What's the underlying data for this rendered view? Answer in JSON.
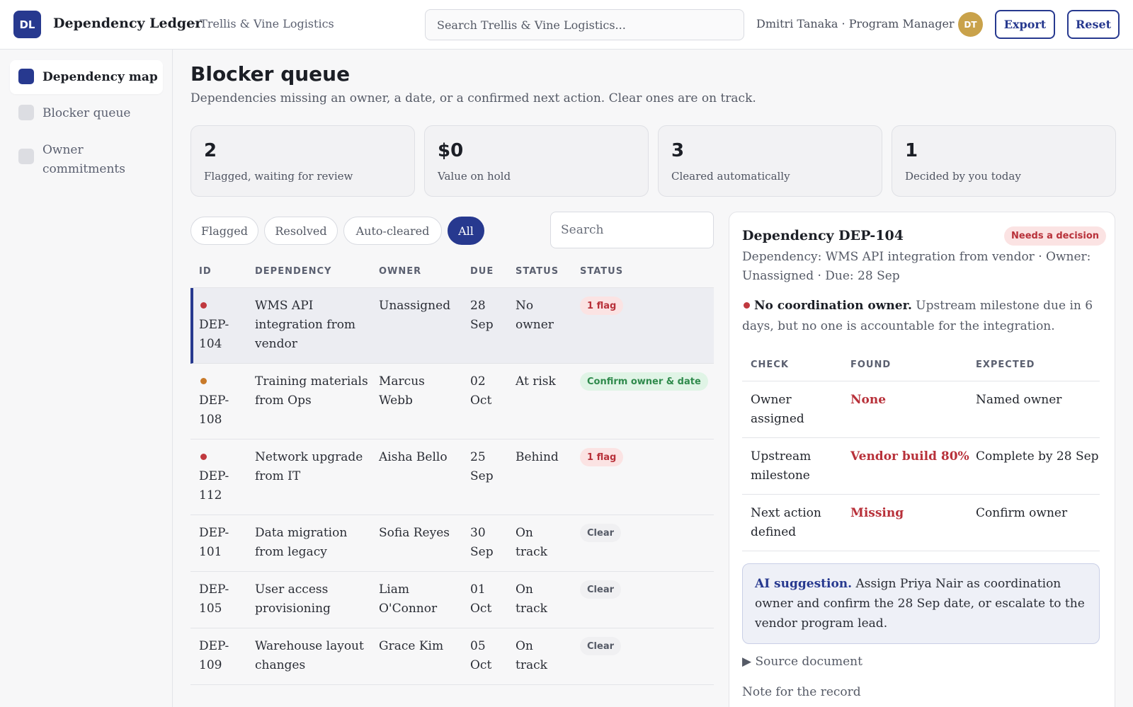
{
  "header": {
    "logo": "DL",
    "app_title": "Dependency Ledger",
    "org": "· Trellis & Vine Logistics",
    "search_placeholder": "Search Trellis & Vine Logistics...",
    "user": "Dmitri Tanaka · Program Manager",
    "avatar": "DT",
    "export_label": "Export",
    "reset_label": "Reset",
    "accent_color": "#27398f"
  },
  "sidebar": {
    "items": [
      {
        "label": "Dependency map",
        "icon": "square-icon",
        "active": true
      },
      {
        "label": "Blocker queue",
        "icon": "square-icon",
        "active": false
      },
      {
        "label": "Owner commitments",
        "icon": "square-icon",
        "active": false
      }
    ]
  },
  "main": {
    "title": "Blocker queue",
    "subtitle": "Dependencies missing an owner, a date, or a confirmed next action. Clear ones are on track.",
    "stats": [
      {
        "value": "2",
        "label": "Flagged, waiting for review"
      },
      {
        "value": "$0",
        "label": "Value on hold"
      },
      {
        "value": "3",
        "label": "Cleared automatically"
      },
      {
        "value": "1",
        "label": "Decided by you today"
      }
    ],
    "filters": [
      {
        "label": "Flagged",
        "active": false
      },
      {
        "label": "Resolved",
        "active": false
      },
      {
        "label": "Auto-cleared",
        "active": false
      },
      {
        "label": "All",
        "active": true
      }
    ],
    "search_placeholder": "Search",
    "columns": [
      "ID",
      "DEPENDENCY",
      "OWNER",
      "DUE",
      "STATUS",
      "STATUS"
    ],
    "rows": [
      {
        "id": "DEP-\n104",
        "dependency": "WMS API integration from vendor",
        "owner": "Unassigned",
        "due": "28 Sep",
        "status": "No owner",
        "badge": "1 flag",
        "badge_type": "flag",
        "dot_color": "#c0393f",
        "selected": true
      },
      {
        "id": "DEP-\n108",
        "dependency": "Training materials from Ops",
        "owner": "Marcus Webb",
        "due": "02 Oct",
        "status": "At risk",
        "badge": "Confirm owner & date",
        "badge_type": "confirm",
        "dot_color": "#c87a2a",
        "selected": false
      },
      {
        "id": "DEP-\n112",
        "dependency": "Network upgrade from IT",
        "owner": "Aisha Bello",
        "due": "25 Sep",
        "status": "Behind",
        "badge": "1 flag",
        "badge_type": "flag",
        "dot_color": "#c0393f",
        "selected": false
      },
      {
        "id": "DEP-\n101",
        "dependency": "Data migration from legacy",
        "owner": "Sofia Reyes",
        "due": "30 Sep",
        "status": "On track",
        "badge": "Clear",
        "badge_type": "clear",
        "dot_color": "",
        "selected": false
      },
      {
        "id": "DEP-\n105",
        "dependency": "User access provisioning",
        "owner": "Liam O'Connor",
        "due": "01 Oct",
        "status": "On track",
        "badge": "Clear",
        "badge_type": "clear",
        "dot_color": "",
        "selected": false
      },
      {
        "id": "DEP-\n109",
        "dependency": "Warehouse layout changes",
        "owner": "Grace Kim",
        "due": "05 Oct",
        "status": "On track",
        "badge": "Clear",
        "badge_type": "clear",
        "dot_color": "",
        "selected": false
      }
    ]
  },
  "detail": {
    "title": "Dependency DEP-104",
    "badge": "Needs a decision",
    "meta": "Dependency: WMS API integration from vendor · Owner: Unassigned · Due: 28 Sep",
    "finding_title": "No coordination owner.",
    "finding_text": " Upstream milestone due in 6 days, but no one is accountable for the integration.",
    "check_columns": [
      "CHECK",
      "FOUND",
      "EXPECTED"
    ],
    "checks": [
      {
        "check": "Owner assigned",
        "found": "None",
        "expected": "Named owner"
      },
      {
        "check": "Upstream milestone",
        "found": "Vendor build 80%",
        "expected": "Complete by 28 Sep"
      },
      {
        "check": "Next action defined",
        "found": "Missing",
        "expected": "Confirm owner"
      }
    ],
    "ai_label": "AI suggestion.",
    "ai_text": " Assign Priya Nair as coordination owner and confirm the 28 Sep date, or escalate to the vendor program lead.",
    "source_toggle": "▶ Source document",
    "note_label": "Note for the record"
  }
}
